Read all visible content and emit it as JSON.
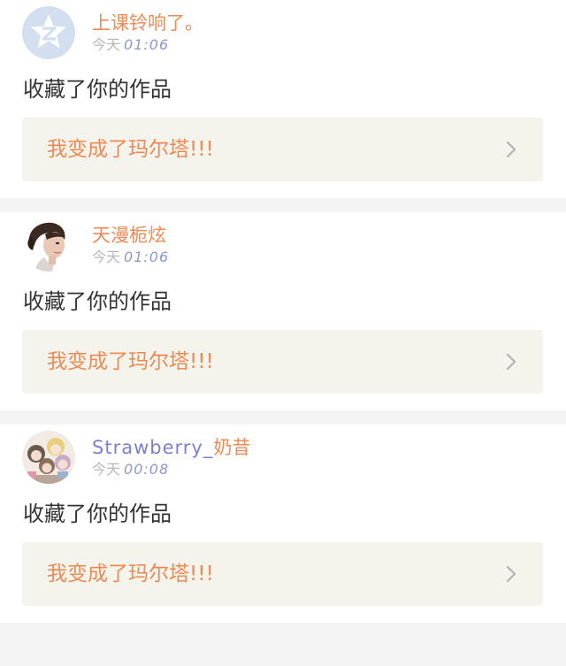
{
  "notifications": [
    {
      "user_name": "上课铃响了。",
      "user_name_latin": "",
      "user_name_cjk": "",
      "avatar_icon": "qq-zone-default-avatar-icon",
      "date": "今天",
      "time": "01:06",
      "action": "收藏了你的作品",
      "work_title": "我变成了玛尔塔!!!"
    },
    {
      "user_name": "天漫栀炫",
      "user_name_latin": "",
      "user_name_cjk": "",
      "avatar_icon": "portrait-avatar-icon",
      "date": "今天",
      "time": "01:06",
      "action": "收藏了你的作品",
      "work_title": "我变成了玛尔塔!!!"
    },
    {
      "user_name": "Strawberry_奶昔",
      "user_name_latin": "Strawberry_",
      "user_name_cjk": "奶昔",
      "avatar_icon": "anime-group-avatar-icon",
      "date": "今天",
      "time": "00:08",
      "action": "收藏了你的作品",
      "work_title": "我变成了玛尔塔!!!"
    }
  ],
  "colors": {
    "accent_orange": "#ee8a55",
    "username_latin": "#7b7fd0",
    "time_blue": "#8e96cf",
    "work_bg": "#f4f4ec"
  }
}
